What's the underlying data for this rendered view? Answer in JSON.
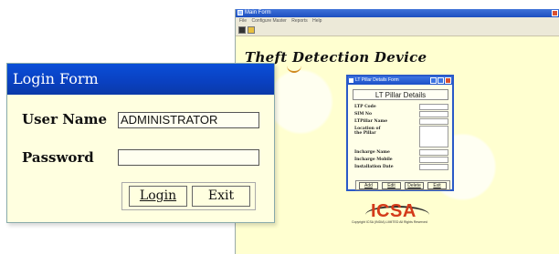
{
  "main_window": {
    "title": "Main Form",
    "menu": [
      "File",
      "Configure Master",
      "Reports",
      "Help"
    ],
    "brand": "Theft Detection Device",
    "logo_text": "ICSA",
    "copyright": "Copyright  ICSA (INDIA) LIMITED  All Rights Reserved"
  },
  "lt_dialog": {
    "title": "LT Pillar Details Form",
    "heading": "LT Pillar Details",
    "fields": [
      {
        "label": "LTP Code"
      },
      {
        "label": "SIM No"
      },
      {
        "label": "LTPillar Name"
      },
      {
        "label": "Location of the Pillar"
      },
      {
        "label": "Incharge Name"
      },
      {
        "label": "Incharge Mobile"
      },
      {
        "label": "Installation Date"
      }
    ],
    "buttons": [
      "Add",
      "Edit",
      "Delete",
      "Exit"
    ]
  },
  "login": {
    "title": "Login Form",
    "username_label": "User Name",
    "username_value": "ADMINISTRATOR",
    "password_label": "Password",
    "password_value": "",
    "login_button": "Login",
    "exit_button": "Exit"
  },
  "colors": {
    "titlebar_blue": "#0a4fd8",
    "form_background": "#ffffe0",
    "logo_red": "#d43a1a"
  }
}
